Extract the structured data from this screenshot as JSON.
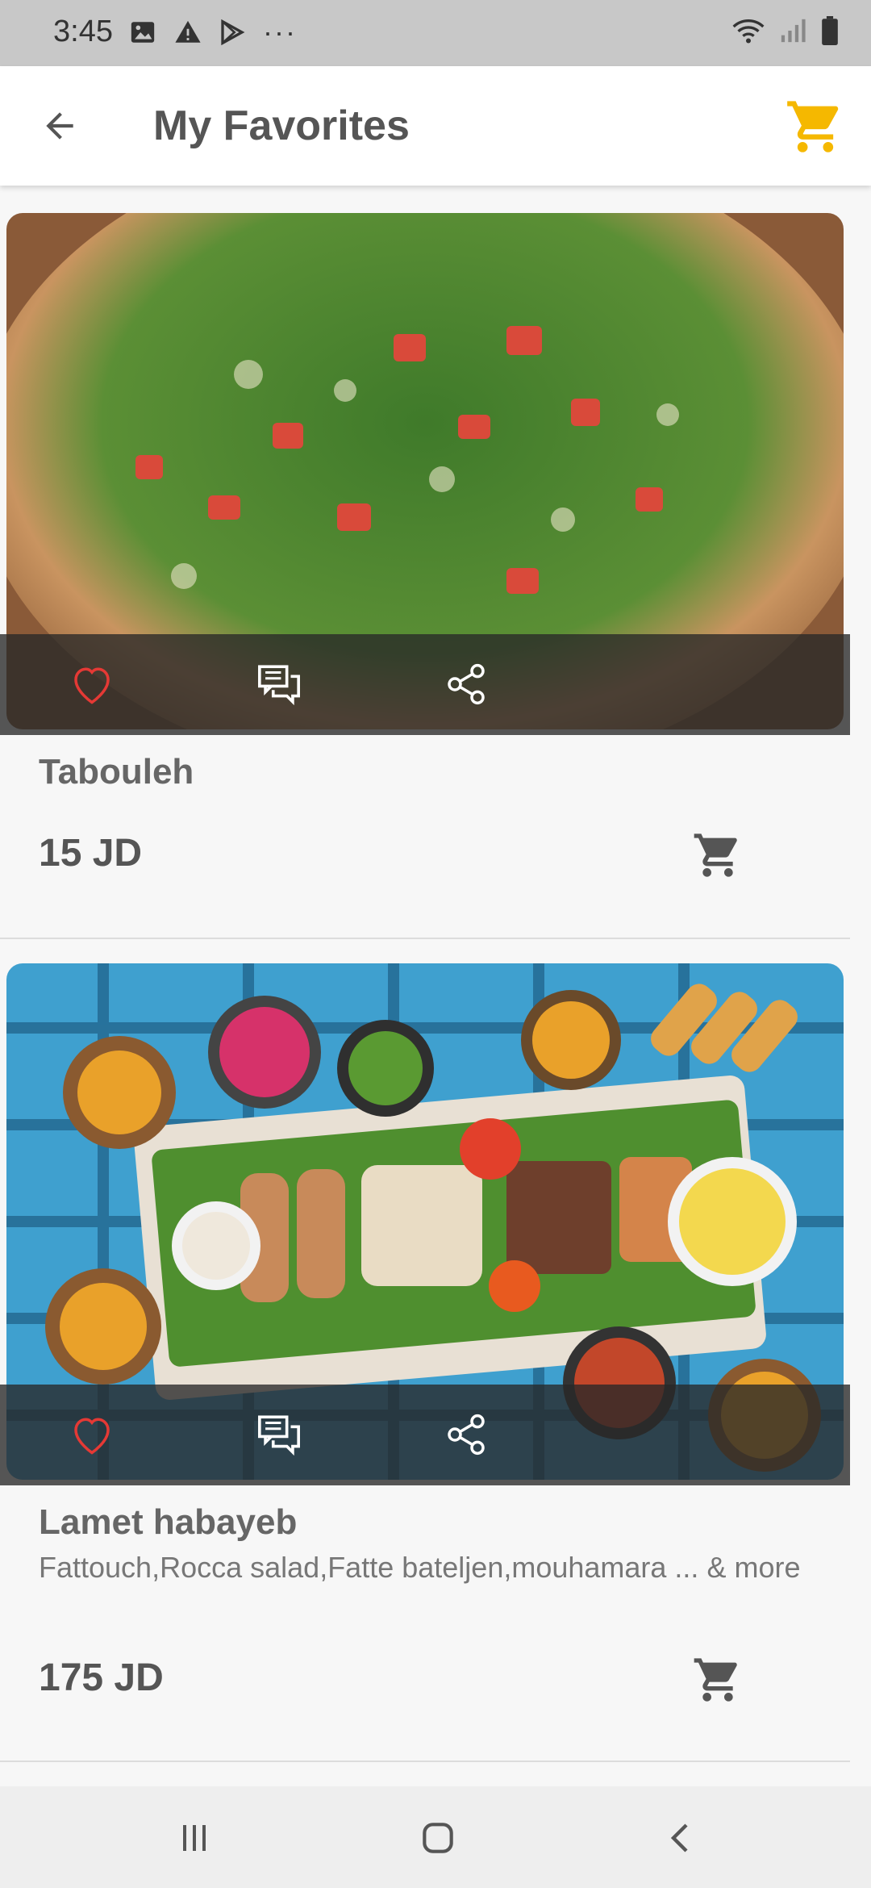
{
  "status_bar": {
    "time": "3:45",
    "left_icons": [
      "image-icon",
      "warning-icon",
      "play-store-icon"
    ],
    "overflow": "···",
    "right_icons": [
      "wifi-icon",
      "signal-icon",
      "battery-icon"
    ]
  },
  "app_bar": {
    "title": "My Favorites",
    "back_icon": "arrow-left-icon",
    "cart_icon": "cart-icon",
    "accent_color": "#F5B800"
  },
  "items": [
    {
      "name": "Tabouleh",
      "description": "",
      "price": "15 JD",
      "favorite": true,
      "actions": [
        "heart-icon",
        "comments-icon",
        "share-icon"
      ]
    },
    {
      "name": "Lamet habayeb",
      "description": "Fattouch,Rocca salad,Fatte bateljen,mouhamara ... & more",
      "price": "175 JD",
      "favorite": true,
      "actions": [
        "heart-icon",
        "comments-icon",
        "share-icon"
      ]
    }
  ],
  "colors": {
    "heart": "#E53935",
    "text_primary": "#555555",
    "status_bar_bg": "#C8C8C8"
  },
  "nav_bar": {
    "buttons": [
      "recent-apps-icon",
      "home-icon",
      "back-icon"
    ]
  }
}
